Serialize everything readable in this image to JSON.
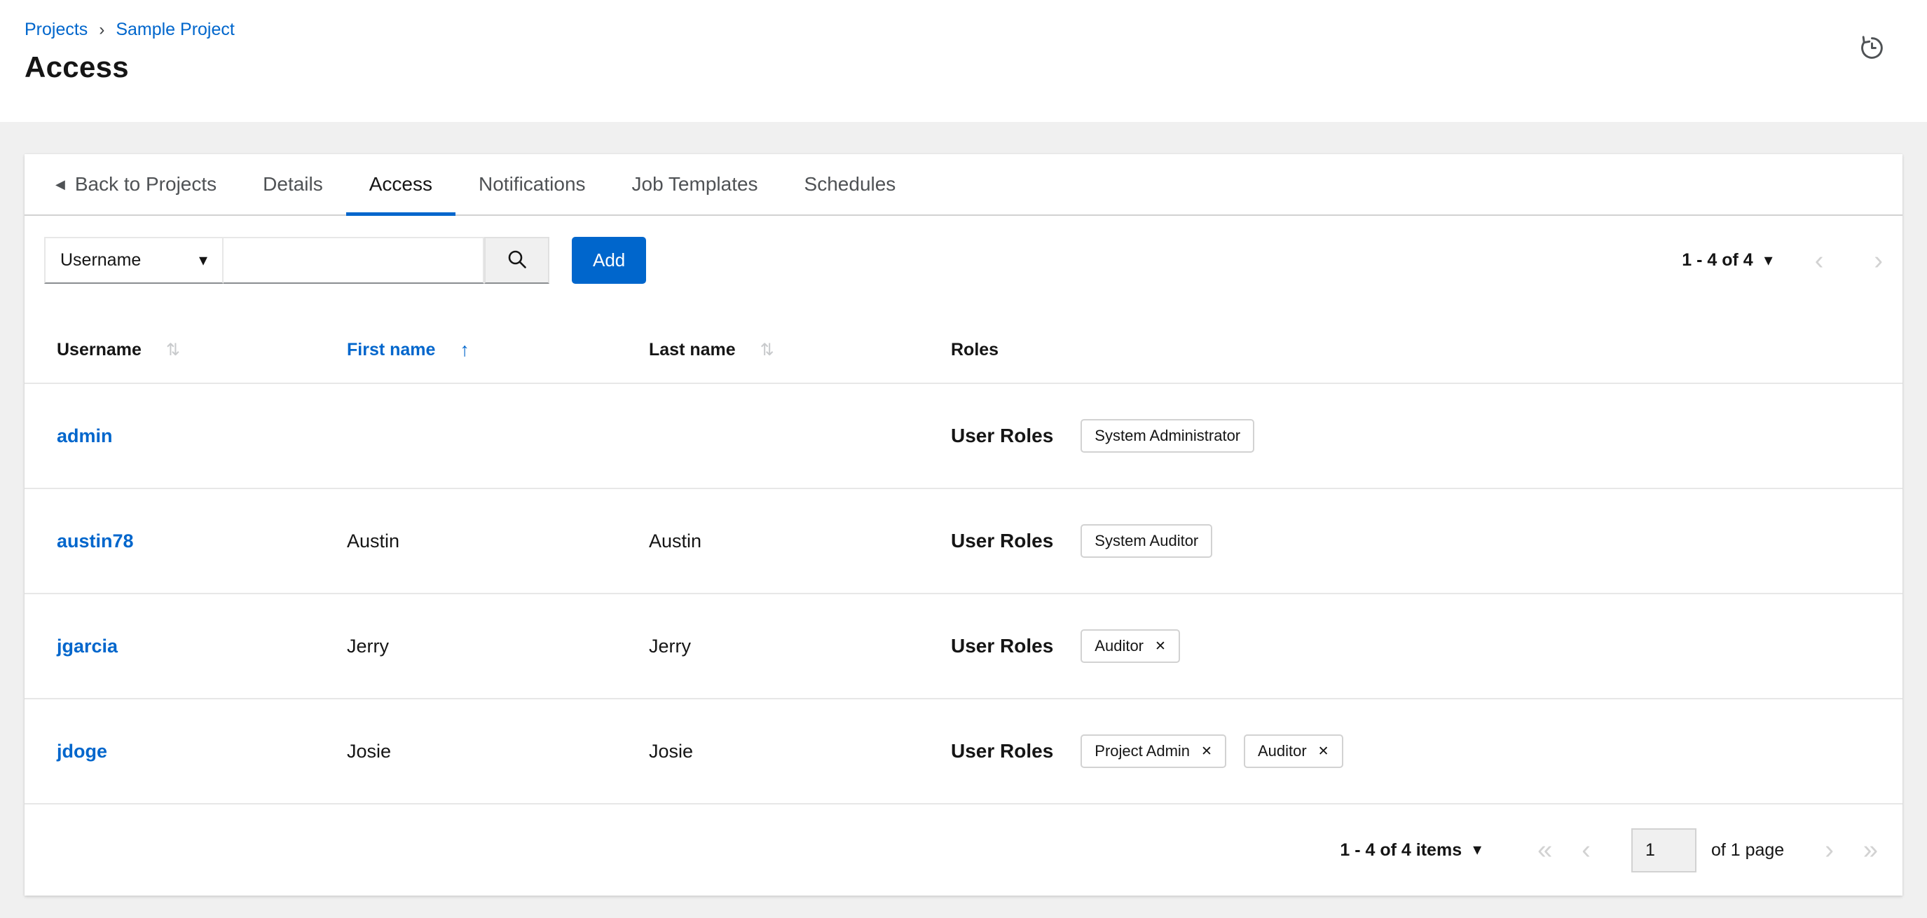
{
  "colors": {
    "primary_blue": "#0066cc",
    "link_blue": "#0066cc",
    "active_tab_underline": "#0066cc",
    "page_background": "#f0f0f0",
    "text_dark": "#151515",
    "text_gray": "#4f5255",
    "disabled_gray": "#d2d2d2"
  },
  "icons": {
    "breadcrumb_separator": "›",
    "back_arrow": "◀",
    "caret_down": "▾",
    "sort_both": "⇅",
    "sort_asc": "↑",
    "chevron_left": "‹",
    "chevron_right": "›",
    "chevron_first": "«",
    "chevron_last": "»",
    "close": "✕",
    "search": "search-icon",
    "history": "history-icon"
  },
  "breadcrumb": {
    "projects": "Projects",
    "current": "Sample Project"
  },
  "page": {
    "title": "Access"
  },
  "tabs": {
    "back": "Back to Projects",
    "items": [
      "Details",
      "Access",
      "Notifications",
      "Job Templates",
      "Schedules"
    ],
    "active": "Access"
  },
  "toolbar": {
    "filter": {
      "selected": "Username"
    },
    "search": {
      "value": ""
    },
    "add_label": "Add",
    "pagination_summary": "1 - 4 of 4"
  },
  "table": {
    "columns": [
      {
        "label": "Username",
        "sortable": true,
        "sorted": null
      },
      {
        "label": "First name",
        "sortable": true,
        "sorted": "ascending"
      },
      {
        "label": "Last name",
        "sortable": true,
        "sorted": null
      },
      {
        "label": "Roles",
        "sortable": false,
        "sorted": null
      }
    ],
    "user_roles_label": "User Roles",
    "rows": [
      {
        "username": "admin",
        "first_name": "",
        "last_name": "",
        "roles": [
          {
            "label": "System Administrator",
            "removable": false
          }
        ]
      },
      {
        "username": "austin78",
        "first_name": "Austin",
        "last_name": "Austin",
        "roles": [
          {
            "label": "System Auditor",
            "removable": false
          }
        ]
      },
      {
        "username": "jgarcia",
        "first_name": "Jerry",
        "last_name": "Jerry",
        "roles": [
          {
            "label": "Auditor",
            "removable": true
          }
        ]
      },
      {
        "username": "jdoge",
        "first_name": "Josie",
        "last_name": "Josie",
        "roles": [
          {
            "label": "Project Admin",
            "removable": true
          },
          {
            "label": "Auditor",
            "removable": true
          }
        ]
      }
    ]
  },
  "footer_pagination": {
    "summary": "1 - 4 of 4 items",
    "current_page": "1",
    "page_count_label": "of 1 page"
  }
}
